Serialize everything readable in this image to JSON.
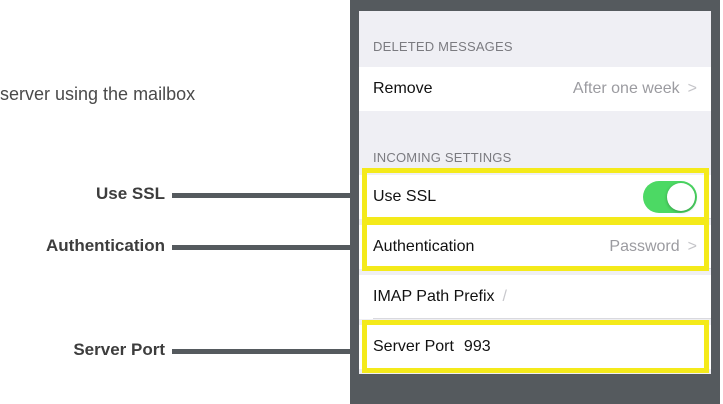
{
  "intro": {
    "text": "server using the mailbox"
  },
  "callouts": [
    {
      "label": "Use SSL"
    },
    {
      "label": "Authentication"
    },
    {
      "label": "Server Port"
    }
  ],
  "settings": {
    "deleted_header": "DELETED MESSAGES",
    "remove": {
      "label": "Remove",
      "value": "After one week",
      "chevron": ">"
    },
    "incoming_header": "INCOMING SETTINGS",
    "use_ssl": {
      "label": "Use SSL",
      "enabled": true
    },
    "authentication": {
      "label": "Authentication",
      "value": "Password",
      "chevron": ">"
    },
    "imap_prefix": {
      "label": "IMAP Path Prefix",
      "value": "/"
    },
    "server_port": {
      "label": "Server Port",
      "value": "993"
    }
  },
  "colors": {
    "highlight": "#f4ea1a",
    "frame": "#555a5e",
    "toggle_on": "#4cd964"
  }
}
